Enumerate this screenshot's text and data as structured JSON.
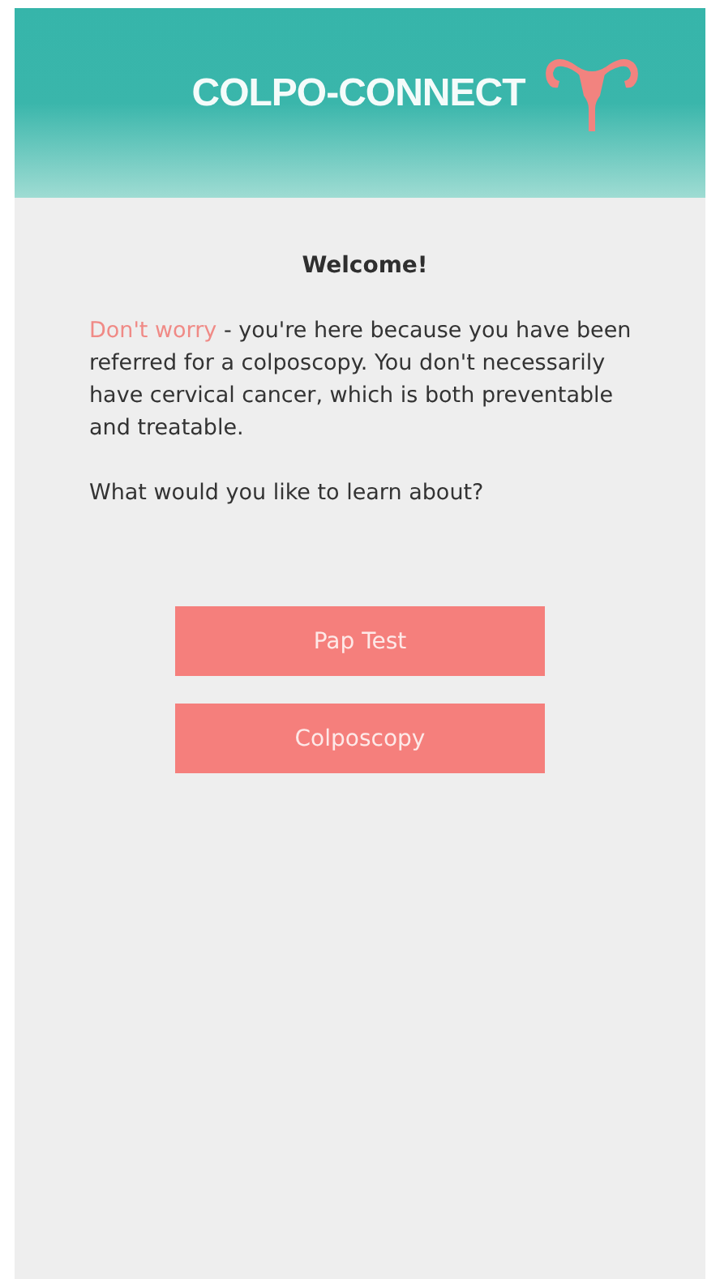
{
  "header": {
    "title": "COLPO-CONNECT"
  },
  "welcome": {
    "heading": "Welcome!",
    "highlight": "Don't worry",
    "message": " - you're here because you have been referred for a colposcopy. You don't necessarily have cervical cancer, which is both preventable and treatable.",
    "question": "What would you like to learn about?"
  },
  "topics": [
    {
      "label": "Pap Test"
    },
    {
      "label": "Colposcopy"
    }
  ]
}
